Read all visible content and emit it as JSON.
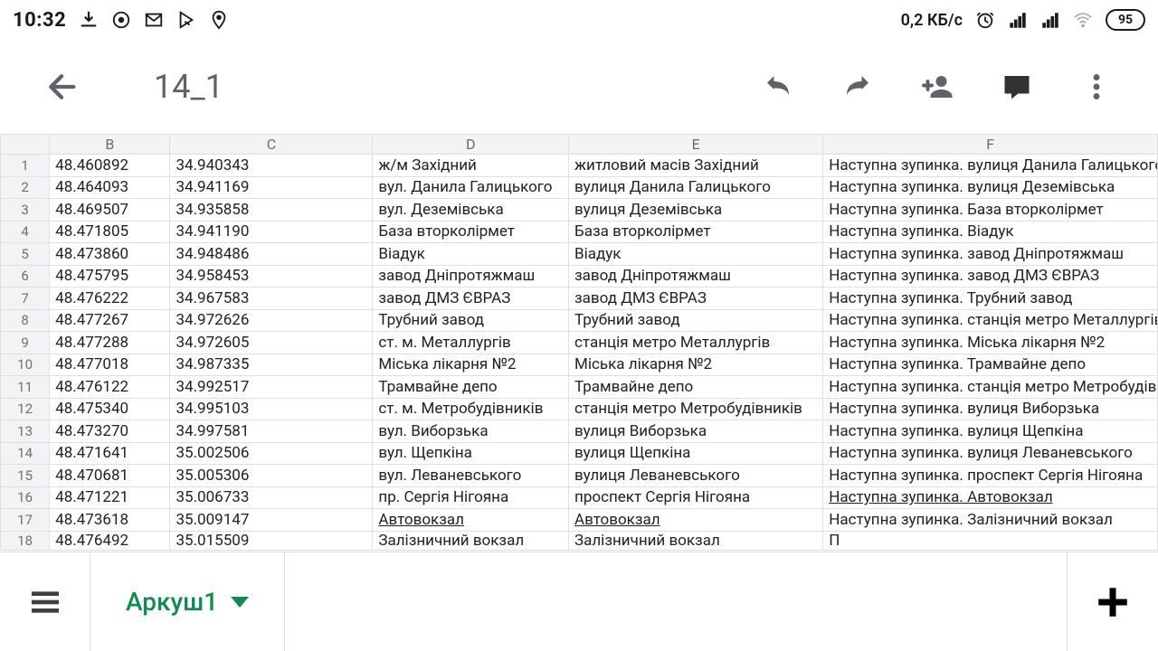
{
  "status": {
    "time": "10:32",
    "kbs": "0,2 КБ/с",
    "battery": "95"
  },
  "toolbar": {
    "title": "14_1"
  },
  "columns": [
    "",
    "B",
    "C",
    "D",
    "E",
    "F"
  ],
  "chart_data": {
    "type": "table",
    "columns": [
      "row",
      "B",
      "C",
      "D",
      "E",
      "F"
    ],
    "underlined": [
      {
        "row": 16,
        "col": "F"
      },
      {
        "row": 17,
        "col": "D"
      },
      {
        "row": 17,
        "col": "E"
      }
    ],
    "rows": [
      {
        "row": 1,
        "B": "48.460892",
        "C": "34.940343",
        "D": "ж/м Західний",
        "E": "житловий масів Західний",
        "F": "Наступна зупинка. вулиця Данила Галицького"
      },
      {
        "row": 2,
        "B": "48.464093",
        "C": "34.941169",
        "D": "вул. Данила Галицького",
        "E": "вулиця Данила Галицького",
        "F": "Наступна зупинка. вулиця Деземівська"
      },
      {
        "row": 3,
        "B": "48.469507",
        "C": "34.935858",
        "D": " вул. Деземівська",
        "E": "вулиця Деземівська",
        "F": "Наступна зупинка. База вторколірмет"
      },
      {
        "row": 4,
        "B": "48.471805",
        "C": "34.941190",
        "D": "База вторколірмет",
        "E": "База вторколірмет",
        "F": "Наступна зупинка. Віадук"
      },
      {
        "row": 5,
        "B": "48.473860",
        "C": "34.948486",
        "D": "Віадук",
        "E": "Віадук",
        "F": "Наступна зупинка. завод Дніпротяжмаш"
      },
      {
        "row": 6,
        "B": "48.475795",
        "C": "34.958453",
        "D": "завод Дніпротяжмаш",
        "E": "завод Дніпротяжмаш",
        "F": "Наступна зупинка. завод ДМЗ ЄВРАЗ"
      },
      {
        "row": 7,
        "B": "48.476222",
        "C": "34.967583",
        "D": "завод ДМЗ ЄВРАЗ",
        "E": "завод ДМЗ ЄВРАЗ",
        "F": "Наступна зупинка. Трубний завод"
      },
      {
        "row": 8,
        "B": "48.477267",
        "C": "34.972626",
        "D": "Трубний завод",
        "E": "Трубний завод",
        "F": "Наступна зупинка. станція метро Металлургів"
      },
      {
        "row": 9,
        "B": "48.477288",
        "C": "34.972605",
        "D": "ст. м. Металлургів",
        "E": "станція метро Металлургів",
        "F": "Наступна зупинка. Міська лікарня №2"
      },
      {
        "row": 10,
        "B": "48.477018",
        "C": "34.987335",
        "D": "Міська лікарня №2",
        "E": "Міська лікарня №2",
        "F": "Наступна зупинка. Трамвайне депо"
      },
      {
        "row": 11,
        "B": "48.476122",
        "C": "34.992517",
        "D": "Трамвайне депо",
        "E": "Трамвайне депо",
        "F": "Наступна зупинка. станція метро Метробудівників"
      },
      {
        "row": 12,
        "B": "48.475340",
        "C": "34.995103",
        "D": "ст. м. Метробудівників",
        "E": "станція метро Метробудівників",
        "F": "Наступна зупинка. вулиця Виборзька"
      },
      {
        "row": 13,
        "B": "48.473270",
        "C": "34.997581",
        "D": "вул. Виборзька",
        "E": "вулиця Виборзька",
        "F": "Наступна зупинка. вулиця Щепкіна"
      },
      {
        "row": 14,
        "B": "48.471641",
        "C": "35.002506",
        "D": "вул. Щепкіна",
        "E": "вулиця Щепкіна",
        "F": "Наступна зупинка. вулиця Леваневського"
      },
      {
        "row": 15,
        "B": "48.470681",
        "C": "35.005306",
        "D": "вул. Леваневського",
        "E": "вулиця Леваневського",
        "F": "Наступна зупинка. проспект Сергія Нігояна"
      },
      {
        "row": 16,
        "B": "48.471221",
        "C": "35.006733",
        "D": "пр. Сергія Нігояна",
        "E": "проспект Сергія Нігояна",
        "F": "Наступна зупинка. Автовокзал"
      },
      {
        "row": 17,
        "B": "48.473618",
        "C": "35.009147",
        "D": "Автовокзал",
        "E": "Автовокзал",
        "F": "Наступна зупинка. Залізничний вокзал"
      },
      {
        "row": 18,
        "B": "48.476492",
        "C": "35.015509",
        "D": "Залізничний вокзал",
        "E": "Залізничний вокзал",
        "F": "П"
      }
    ]
  },
  "bottom": {
    "sheet_name": "Аркуш1"
  }
}
